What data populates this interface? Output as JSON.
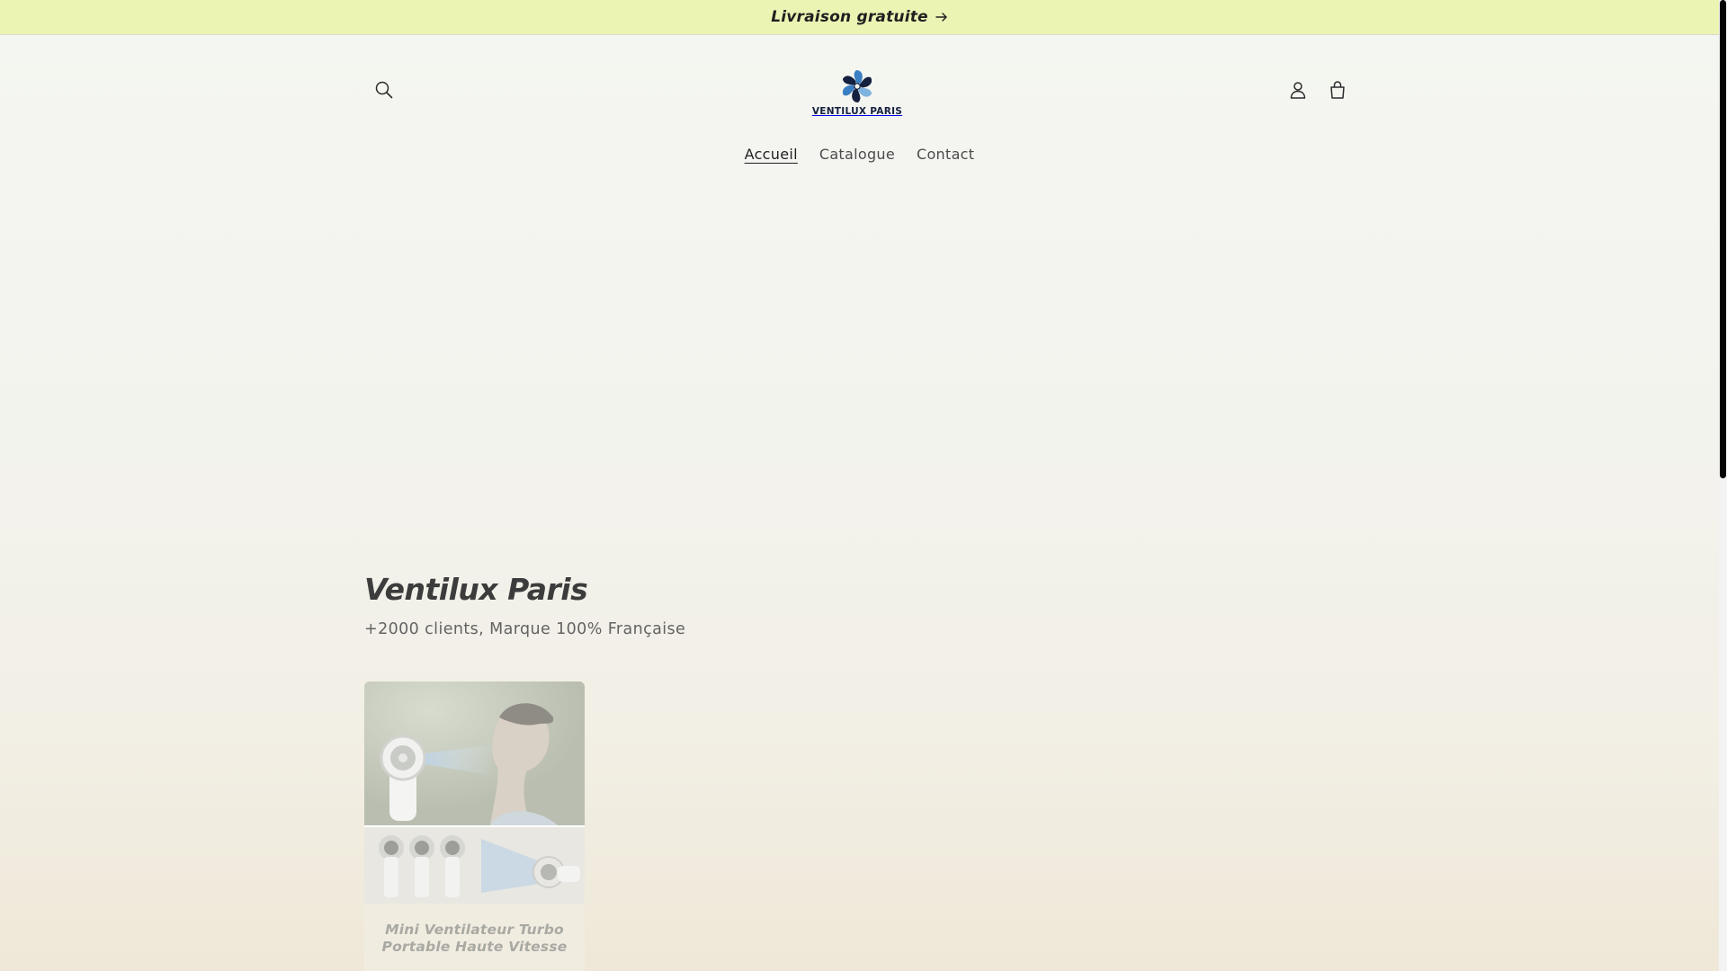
{
  "announcement": {
    "text": "Livraison gratuite",
    "arrow_icon": "arrow-right-icon",
    "background": "#ecf4b4"
  },
  "header": {
    "search_icon": "search-icon",
    "login_icon": "account-icon",
    "cart_icon": "cart-icon",
    "logo_text": "VENTILUX PARIS"
  },
  "nav": {
    "items": [
      {
        "label": "Accueil",
        "active": true
      },
      {
        "label": "Catalogue",
        "active": false
      },
      {
        "label": "Contact",
        "active": false
      }
    ]
  },
  "hero": {
    "title": "Ventilux Paris",
    "subtitle": "+2000 clients, Marque 100% Française"
  },
  "products": [
    {
      "title": "Mini Ventilateur Turbo Portable Haute Vitesse"
    }
  ],
  "colors": {
    "page_background": "#f3f3ee",
    "text": "#1f1f1f",
    "logo_navy": "#15203f",
    "logo_blue": "#3a7fc3"
  }
}
